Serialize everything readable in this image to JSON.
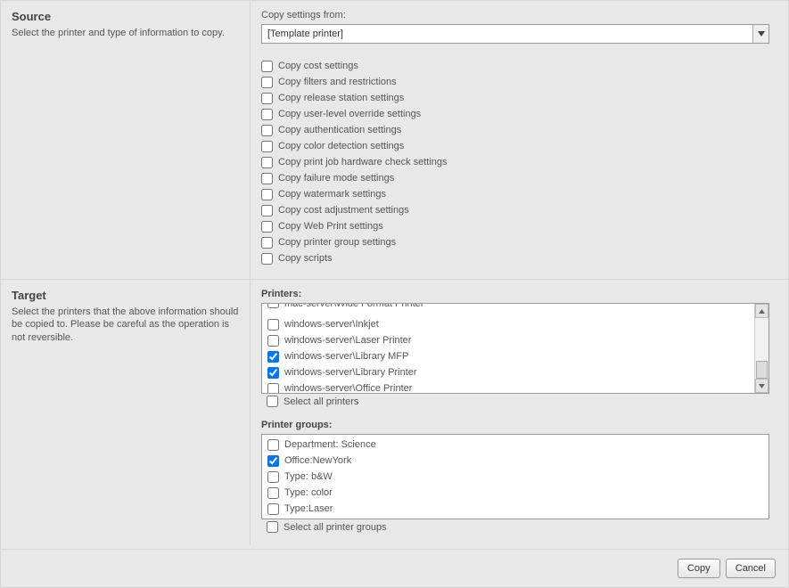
{
  "source": {
    "title": "Source",
    "desc": "Select the printer and type of information to copy.",
    "copy_from_label": "Copy settings from:",
    "template_value": "[Template printer]",
    "options": [
      {
        "label": "Copy cost settings",
        "checked": false
      },
      {
        "label": "Copy filters and restrictions",
        "checked": false
      },
      {
        "label": "Copy release station settings",
        "checked": false
      },
      {
        "label": "Copy user-level override settings",
        "checked": false
      },
      {
        "label": "Copy authentication settings",
        "checked": false
      },
      {
        "label": "Copy color detection settings",
        "checked": false
      },
      {
        "label": "Copy print job hardware check settings",
        "checked": false
      },
      {
        "label": "Copy failure mode settings",
        "checked": false
      },
      {
        "label": "Copy watermark settings",
        "checked": false
      },
      {
        "label": "Copy cost adjustment settings",
        "checked": false
      },
      {
        "label": "Copy Web Print settings",
        "checked": false
      },
      {
        "label": "Copy printer group settings",
        "checked": false
      },
      {
        "label": "Copy scripts",
        "checked": false
      }
    ]
  },
  "target": {
    "title": "Target",
    "desc": "Select the printers that the above information should be copied to. Please be careful as the operation is not reversible.",
    "printers_label": "Printers:",
    "printers": [
      {
        "label": "mac-server\\Wide Format Printer",
        "checked": false
      },
      {
        "label": "windows-server\\Inkjet",
        "checked": false
      },
      {
        "label": "windows-server\\Laser Printer",
        "checked": false
      },
      {
        "label": "windows-server\\Library MFP",
        "checked": true
      },
      {
        "label": "windows-server\\Library Printer",
        "checked": true
      },
      {
        "label": "windows-server\\Office Printer",
        "checked": false
      }
    ],
    "select_all_printers": "Select all printers",
    "groups_label": "Printer groups:",
    "groups": [
      {
        "label": "Department: Science",
        "checked": false
      },
      {
        "label": "Office:NewYork",
        "checked": true
      },
      {
        "label": "Type: b&W",
        "checked": false
      },
      {
        "label": "Type: color",
        "checked": false
      },
      {
        "label": "Type:Laser",
        "checked": false
      }
    ],
    "select_all_groups": "Select all printer groups"
  },
  "footer": {
    "copy": "Copy",
    "cancel": "Cancel"
  }
}
